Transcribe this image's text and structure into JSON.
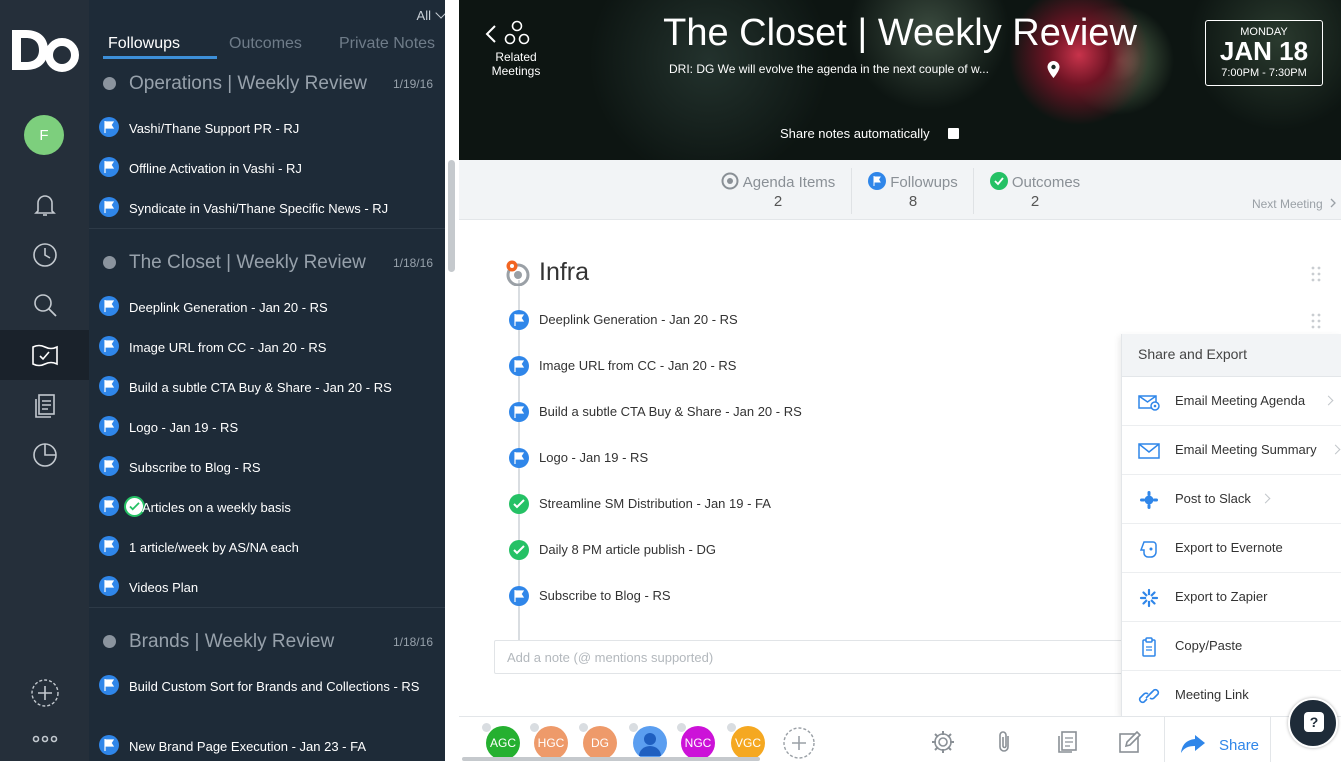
{
  "app": {
    "logo": "Do",
    "user_initial": "F"
  },
  "rail": {
    "items": [
      {
        "icon": "bell-icon"
      },
      {
        "icon": "clock-icon"
      },
      {
        "icon": "search-icon"
      },
      {
        "icon": "meetings-flag-icon",
        "active": true
      },
      {
        "icon": "notes-icon"
      },
      {
        "icon": "pie-chart-icon"
      }
    ]
  },
  "panel": {
    "filter": "All",
    "tabs": [
      {
        "label": "Followups",
        "active": true
      },
      {
        "label": "Outcomes"
      },
      {
        "label": "Private Notes"
      }
    ],
    "groups": [
      {
        "title": "Operations | Weekly Review",
        "date": "1/19/16",
        "items": [
          "Vashi/Thane Support PR - RJ",
          "Offline Activation in Vashi - RJ",
          "Syndicate in Vashi/Thane Specific News - RJ"
        ]
      },
      {
        "title": "The Closet | Weekly Review",
        "date": "1/18/16",
        "items": [
          "Deeplink Generation - Jan 20 - RS",
          "Image URL from CC - Jan 20 - RS",
          "Build a subtle CTA Buy & Share - Jan 20 - RS",
          "Logo - Jan 19 - RS",
          "Subscribe to Blog - RS",
          "Articles on a weekly basis",
          "1 article/week by AS/NA each",
          "Videos Plan"
        ]
      },
      {
        "title": "Brands | Weekly Review",
        "date": "1/18/16",
        "items": [
          "Build Custom Sort for Brands and Collections - RS",
          "New Brand Page Execution - Jan 23 - FA"
        ]
      }
    ]
  },
  "header": {
    "related_label": "Related Meetings",
    "title": "The Closet | Weekly Review",
    "dri": "DRI: DG We will evolve the agenda in the next couple of w...",
    "date": {
      "day": "MONDAY",
      "big": "JAN 18",
      "time": "7:00PM - 7:30PM"
    },
    "share_auto_label": "Share notes automatically"
  },
  "stats": {
    "agenda": {
      "label": "Agenda Items",
      "value": "2"
    },
    "followups": {
      "label": "Followups",
      "value": "8"
    },
    "outcomes": {
      "label": "Outcomes",
      "value": "2"
    },
    "next_meeting": "Next Meeting"
  },
  "content": {
    "section_title": "Infra",
    "items": [
      {
        "text": "Deeplink Generation - Jan 20 - RS",
        "type": "followup"
      },
      {
        "text": "Image URL from CC - Jan 20 - RS",
        "type": "followup"
      },
      {
        "text": "Build a subtle CTA Buy & Share - Jan 20 - RS",
        "type": "followup"
      },
      {
        "text": "Logo - Jan 19 - RS",
        "type": "followup"
      },
      {
        "text": "Streamline SM Distribution - Jan 19 -  FA",
        "type": "outcome"
      },
      {
        "text": "Daily 8 PM article publish - DG",
        "type": "outcome"
      },
      {
        "text": "Subscribe to Blog - RS",
        "type": "followup"
      }
    ],
    "note_placeholder": "Add a note (@ mentions supported)"
  },
  "share_menu": {
    "title": "Share and Export",
    "items": [
      {
        "label": "Email Meeting Agenda",
        "icon": "email-agenda-icon",
        "has_submenu": true
      },
      {
        "label": "Email Meeting Summary",
        "icon": "email-icon",
        "has_submenu": true
      },
      {
        "label": "Post to Slack",
        "icon": "slack-icon",
        "has_submenu": true
      },
      {
        "label": "Export to Evernote",
        "icon": "evernote-icon"
      },
      {
        "label": "Export to Zapier",
        "icon": "zapier-icon"
      },
      {
        "label": "Copy/Paste",
        "icon": "clipboard-icon"
      },
      {
        "label": "Meeting Link",
        "icon": "link-icon"
      }
    ]
  },
  "attendees": [
    {
      "initials": "AGC",
      "color": "#25b030"
    },
    {
      "initials": "HGC",
      "color": "#ee9a6a"
    },
    {
      "initials": "DG",
      "color": "#ee9a6a"
    },
    {
      "initials": "",
      "color": "#5b9ef0"
    },
    {
      "initials": "NGC",
      "color": "#cc12d8"
    },
    {
      "initials": "VGC",
      "color": "#f5a821"
    }
  ],
  "bottombar": {
    "share_label": "Share"
  },
  "colors": {
    "accent": "#2f86e9",
    "success": "#25c165",
    "panel_bg": "#1e2b38",
    "rail_bg": "#252f3a"
  }
}
